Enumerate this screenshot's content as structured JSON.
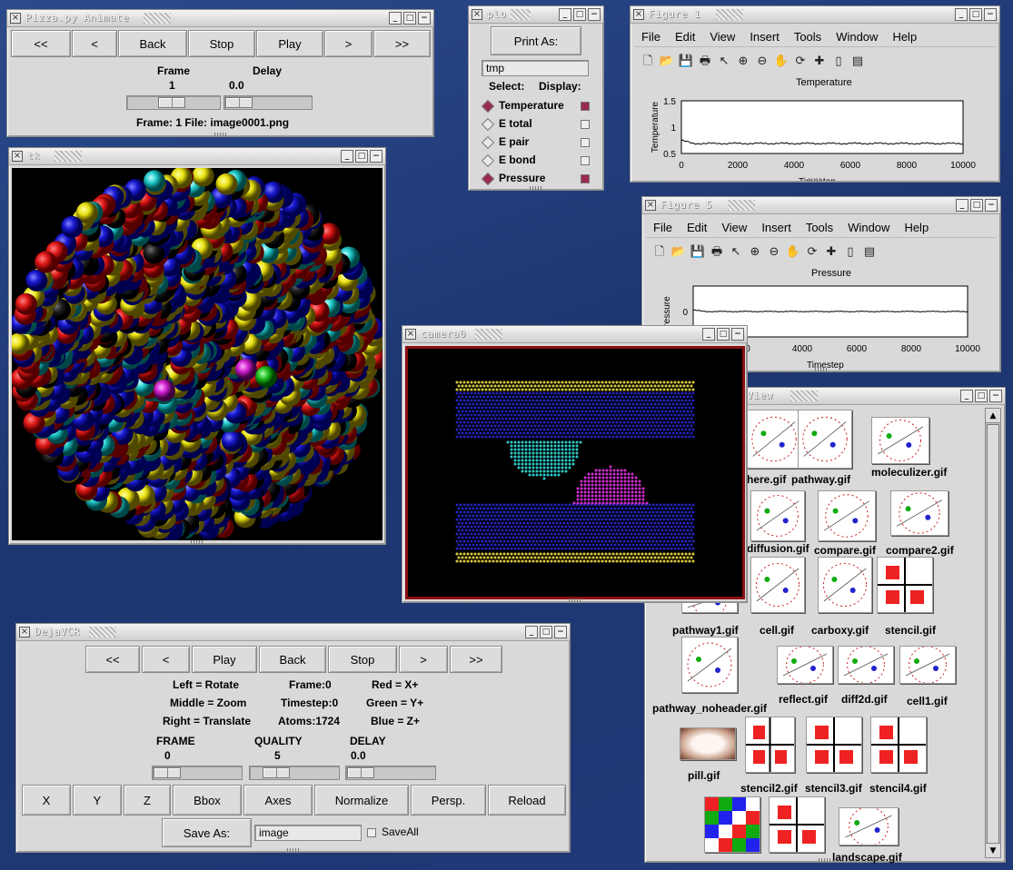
{
  "animate": {
    "title": "Pizza.py Animate",
    "buttons": [
      "<<",
      "<",
      "Back",
      "Stop",
      "Play",
      ">",
      ">>"
    ],
    "frame_label": "Frame",
    "delay_label": "Delay",
    "frame_value": "1",
    "delay_value": "0.0",
    "status": "Frame: 1    File: image0001.png"
  },
  "tk": {
    "title": "tk"
  },
  "plo": {
    "title": "plo",
    "print_button": "Print As:",
    "file_value": "tmp",
    "select_label": "Select:",
    "display_label": "Display:",
    "items": [
      {
        "label": "Temperature",
        "selected": true,
        "displayed": true
      },
      {
        "label": "E total",
        "selected": false,
        "displayed": false
      },
      {
        "label": "E pair",
        "selected": false,
        "displayed": false
      },
      {
        "label": "E bond",
        "selected": false,
        "displayed": false
      },
      {
        "label": "Pressure",
        "selected": true,
        "displayed": true
      }
    ]
  },
  "figure1": {
    "title": "Figure 1",
    "menu": [
      "File",
      "Edit",
      "View",
      "Insert",
      "Tools",
      "Window",
      "Help"
    ],
    "plot_title": "Temperature",
    "ylabel": "Temperature",
    "xlabel": "Timestep",
    "yticks": [
      "1.5",
      "1",
      "0.5"
    ],
    "xticks": [
      "0",
      "2000",
      "4000",
      "6000",
      "8000",
      "10000"
    ]
  },
  "figure5": {
    "title": "Figure 5",
    "menu": [
      "File",
      "Edit",
      "View",
      "Insert",
      "Tools",
      "Window",
      "Help"
    ],
    "plot_title": "Pressure",
    "ylabel": "ressure",
    "xlabel": "Timestep",
    "yticks": [
      "0"
    ],
    "xticks": [
      "0",
      "4000",
      "6000",
      "8000",
      "10000"
    ]
  },
  "camera": {
    "title": "camera0"
  },
  "imageview": {
    "title": "eView",
    "thumbs": [
      {
        "label": "here.gif"
      },
      {
        "label": "pathway.gif"
      },
      {
        "label": "moleculizer.gif"
      },
      {
        "label": "diffusion.gif"
      },
      {
        "label": "compare.gif"
      },
      {
        "label": "compare2.gif"
      },
      {
        "label": "pathway1.gif"
      },
      {
        "label": "cell.gif"
      },
      {
        "label": "carboxy.gif"
      },
      {
        "label": "stencil.gif"
      },
      {
        "label": "pathway_noheader.gif"
      },
      {
        "label": "reflect.gif"
      },
      {
        "label": "diff2d.gif"
      },
      {
        "label": "cell1.gif"
      },
      {
        "label": "pill.gif"
      },
      {
        "label": "stencil2.gif"
      },
      {
        "label": "stencil3.gif"
      },
      {
        "label": "stencil4.gif"
      },
      {
        "label": "landscape.gif"
      }
    ]
  },
  "dejavcr": {
    "title": "DejaVCR",
    "buttons": [
      "<<",
      "<",
      "Play",
      "Back",
      "Stop",
      ">",
      ">>"
    ],
    "info": {
      "left": "Left = Rotate",
      "middle": "Middle = Zoom",
      "right": "Right = Translate",
      "frame": "Frame:0",
      "timestep": "Timestep:0",
      "atoms": "Atoms:1724",
      "red": "Red = X+",
      "green": "Green = Y+",
      "blue": "Blue = Z+"
    },
    "frame_label": "FRAME",
    "quality_label": "QUALITY",
    "delay_label": "DELAY",
    "frame_value": "0",
    "quality_value": "5",
    "delay_value": "0.0",
    "view_buttons": [
      "X",
      "Y",
      "Z",
      "Bbox",
      "Axes",
      "Normalize",
      "Persp.",
      "Reload"
    ],
    "save_button": "Save As:",
    "save_value": "image",
    "saveall_label": "SaveAll"
  },
  "colors": {
    "desktop": "#1f3a78",
    "plot_highlight": "#9c2a50",
    "camera_border": "#8a1010"
  }
}
